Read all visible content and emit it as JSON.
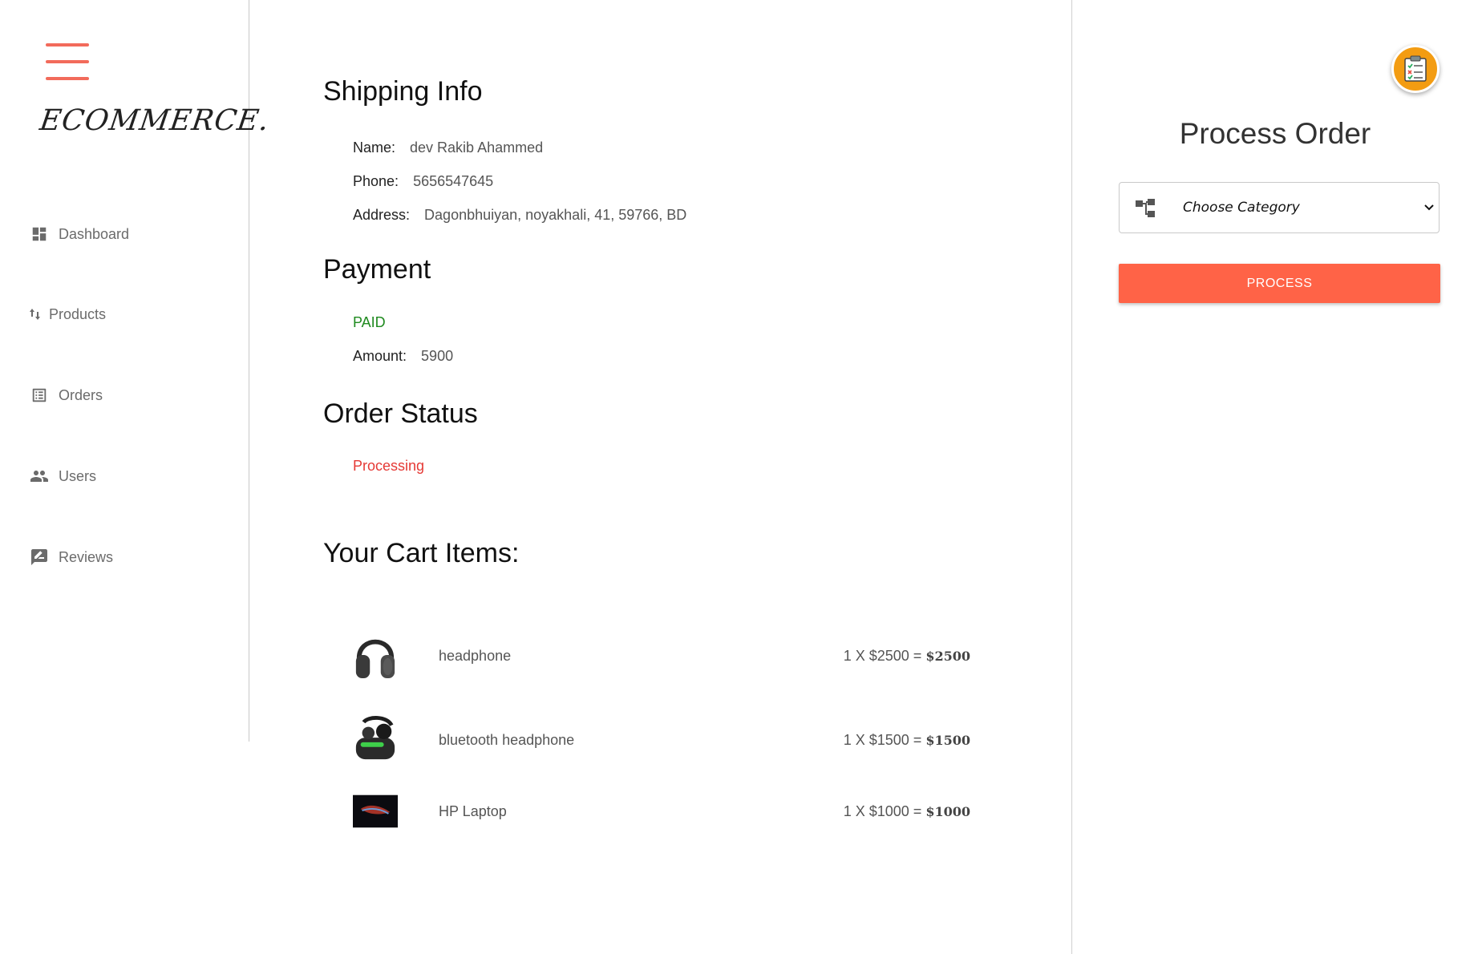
{
  "sidebar": {
    "logo": "ECOMMERCE.",
    "items": [
      {
        "label": "Dashboard",
        "icon": "dashboard-icon"
      },
      {
        "label": "Products",
        "icon": "sort-arrows-icon"
      },
      {
        "label": "Orders",
        "icon": "list-icon"
      },
      {
        "label": "Users",
        "icon": "people-icon"
      },
      {
        "label": "Reviews",
        "icon": "rate-review-icon"
      }
    ]
  },
  "shipping": {
    "title": "Shipping Info",
    "name_label": "Name:",
    "name": "dev Rakib Ahammed",
    "phone_label": "Phone:",
    "phone": "5656547645",
    "address_label": "Address:",
    "address": "Dagonbhuiyan, noyakhali, 41, 59766, BD"
  },
  "payment": {
    "title": "Payment",
    "status": "PAID",
    "amount_label": "Amount:",
    "amount": "5900"
  },
  "order_status": {
    "title": "Order Status",
    "status": "Processing"
  },
  "cart": {
    "title": "Your Cart Items:",
    "items": [
      {
        "name": "headphone",
        "qty_price": "1 X $2500 = ",
        "total": "$2500"
      },
      {
        "name": "bluetooth headphone",
        "qty_price": "1 X $1500 = ",
        "total": "$1500"
      },
      {
        "name": "HP Laptop",
        "qty_price": "1 X $1000 = ",
        "total": "$1000"
      }
    ]
  },
  "process": {
    "title": "Process Order",
    "select_value": "Choose Category",
    "button_label": "PROCESS"
  },
  "colors": {
    "accent": "#ff6347",
    "paid": "#1f8a1f",
    "processing": "#e53935",
    "fab": "#f39c12"
  }
}
